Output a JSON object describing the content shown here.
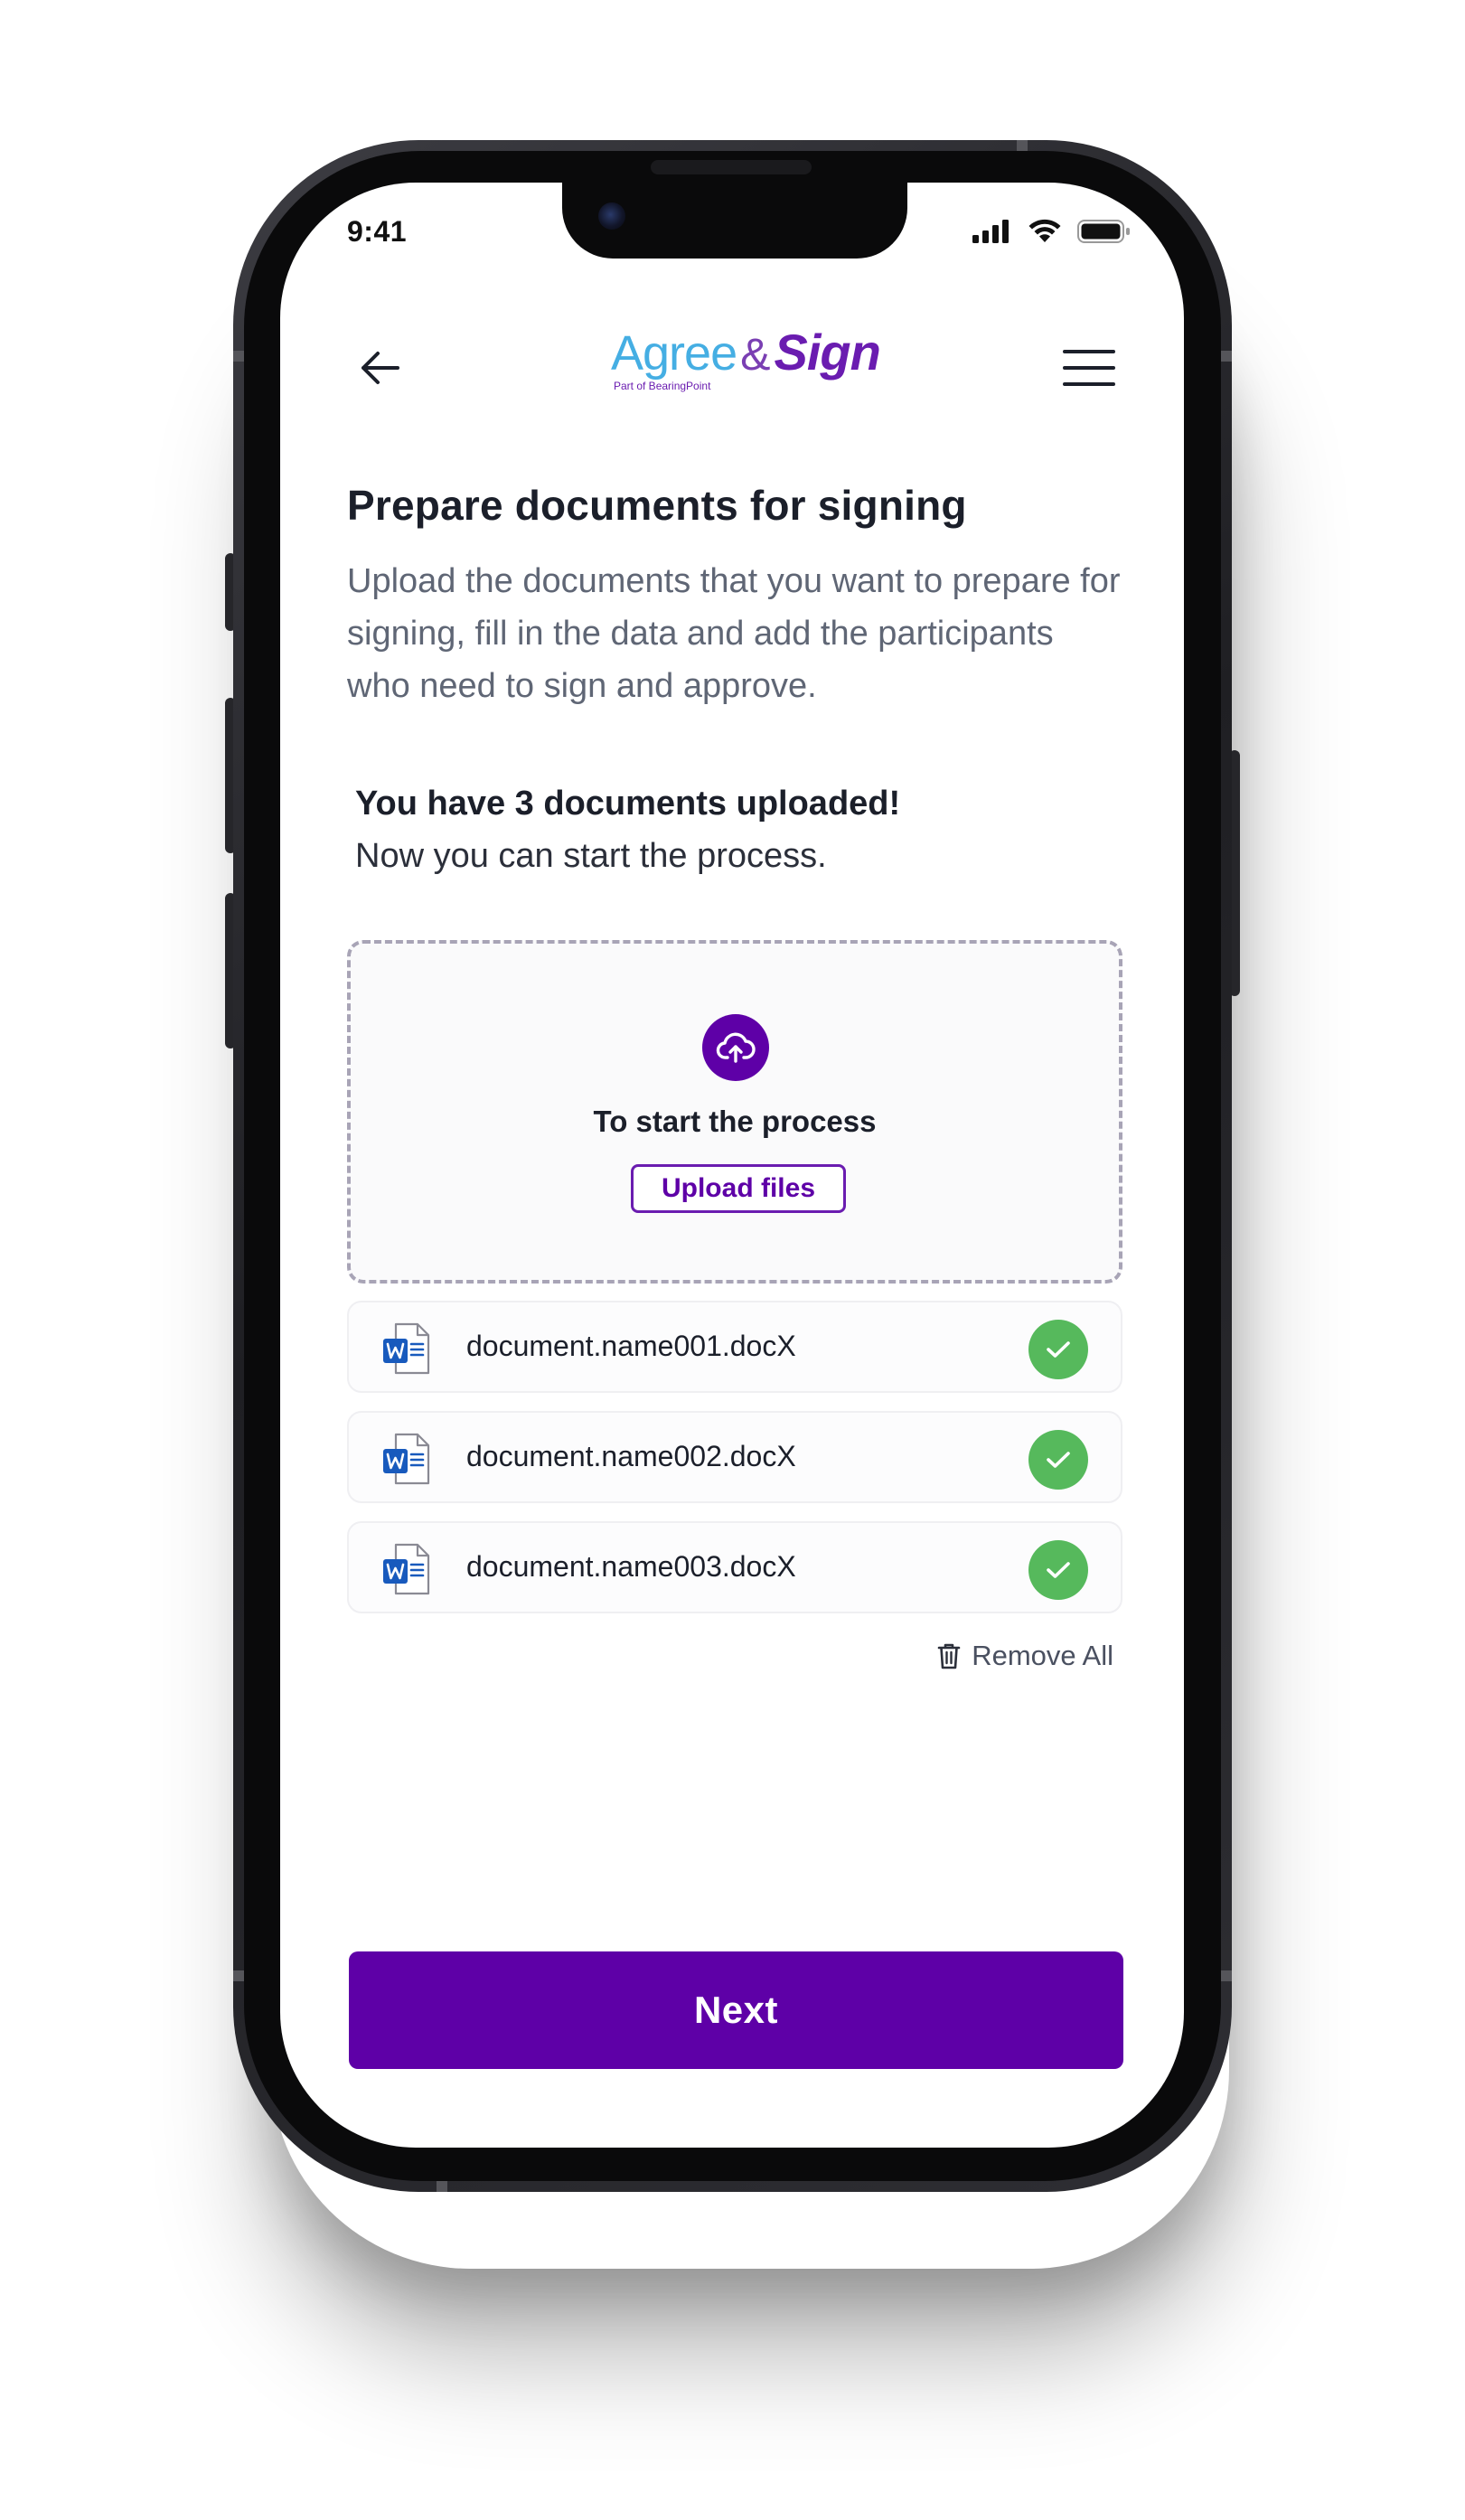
{
  "status_bar": {
    "time": "9:41",
    "icons": [
      "signal-icon",
      "wifi-icon",
      "battery-icon"
    ]
  },
  "header": {
    "back_icon": "arrow-left-icon",
    "menu_icon": "hamburger-menu-icon",
    "logo": {
      "agree": "Agree",
      "amp": "&",
      "sign": "Sign",
      "subtitle": "Part of BearingPoint"
    }
  },
  "main": {
    "title": "Prepare documents for signing",
    "description": "Upload the documents that you want to prepare for signing, fill in the data and add the participants who need to sign and approve.",
    "uploaded_title": "You have 3 documents uploaded!",
    "uploaded_sub": "Now you can start the process.",
    "dropzone": {
      "icon": "cloud-upload-icon",
      "title": "To start the process",
      "button_label": "Upload files"
    },
    "documents": [
      {
        "name": "document.name001.docX",
        "icon": "word-file-icon",
        "status_icon": "check-icon"
      },
      {
        "name": "document.name002.docX",
        "icon": "word-file-icon",
        "status_icon": "check-icon"
      },
      {
        "name": "document.name003.docX",
        "icon": "word-file-icon",
        "status_icon": "check-icon"
      }
    ],
    "remove_all_label": "Remove All",
    "next_label": "Next"
  },
  "colors": {
    "brand_purple": "#5e00a7",
    "logo_blue": "#45aee3",
    "success_green": "#56b95c",
    "word_blue": "#185abd"
  }
}
